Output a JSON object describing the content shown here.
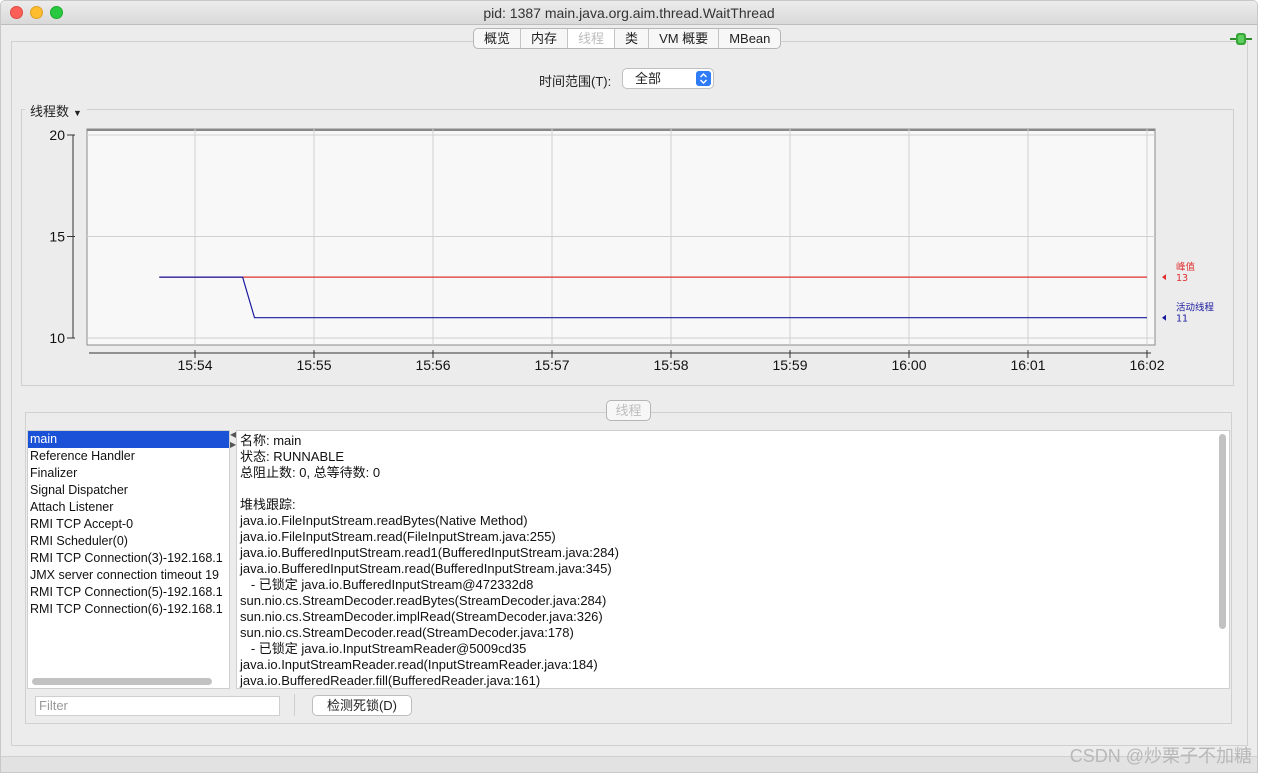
{
  "window": {
    "title": "pid: 1387 main.java.org.aim.thread.WaitThread"
  },
  "tabs": [
    {
      "label": "概览",
      "active": false
    },
    {
      "label": "内存",
      "active": false
    },
    {
      "label": "线程",
      "active": true
    },
    {
      "label": "类",
      "active": false
    },
    {
      "label": "VM 概要",
      "active": false
    },
    {
      "label": "MBean",
      "active": false
    }
  ],
  "range": {
    "label": "时间范围(T):",
    "value": "全部"
  },
  "chart_panel": {
    "selector_label": "线程数"
  },
  "chart_data": {
    "type": "line",
    "ylim": [
      10,
      20
    ],
    "yticks": [
      "20",
      "15",
      "10"
    ],
    "xticks": [
      "15:54",
      "15:55",
      "15:56",
      "15:57",
      "15:58",
      "15:59",
      "16:00",
      "16:01",
      "16:02"
    ],
    "series": [
      {
        "name": "峰值",
        "color": "#e03030",
        "last_value": "13",
        "points": [
          [
            -0.3,
            13
          ],
          [
            8.0,
            13
          ]
        ]
      },
      {
        "name": "活动线程",
        "color": "#1a1aa0",
        "last_value": "11",
        "points": [
          [
            -0.3,
            13
          ],
          [
            0.4,
            13
          ],
          [
            0.5,
            11
          ],
          [
            8.0,
            11
          ]
        ]
      }
    ]
  },
  "threads_panel": {
    "title": "线程",
    "threads": [
      "main",
      "Reference Handler",
      "Finalizer",
      "Signal Dispatcher",
      "Attach Listener",
      "RMI TCP Accept-0",
      "RMI Scheduler(0)",
      "RMI TCP Connection(3)-192.168.1",
      "JMX server connection timeout 19",
      "RMI TCP Connection(5)-192.168.1",
      "RMI TCP Connection(6)-192.168.1"
    ],
    "selected_index": 0,
    "details": [
      "名称: main",
      "状态: RUNNABLE",
      "总阻止数: 0, 总等待数: 0",
      "",
      "堆栈跟踪:",
      "java.io.FileInputStream.readBytes(Native Method)",
      "java.io.FileInputStream.read(FileInputStream.java:255)",
      "java.io.BufferedInputStream.read1(BufferedInputStream.java:284)",
      "java.io.BufferedInputStream.read(BufferedInputStream.java:345)",
      "   - 已锁定 java.io.BufferedInputStream@472332d8",
      "sun.nio.cs.StreamDecoder.readBytes(StreamDecoder.java:284)",
      "sun.nio.cs.StreamDecoder.implRead(StreamDecoder.java:326)",
      "sun.nio.cs.StreamDecoder.read(StreamDecoder.java:178)",
      "   - 已锁定 java.io.InputStreamReader@5009cd35",
      "java.io.InputStreamReader.read(InputStreamReader.java:184)",
      "java.io.BufferedReader.fill(BufferedReader.java:161)"
    ],
    "filter_placeholder": "Filter",
    "deadlock_button": "检测死锁(D)"
  },
  "watermark": "CSDN @炒栗子不加糖"
}
